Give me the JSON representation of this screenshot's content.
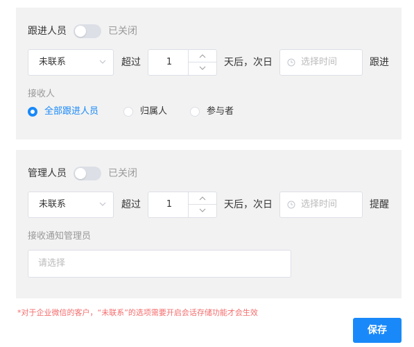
{
  "followup": {
    "label": "跟进人员",
    "toggle_state": "已关闭",
    "status_select": "未联系",
    "exceed_label": "超过",
    "days_value": "1",
    "days_suffix": "天后，次日",
    "time_placeholder": "选择时间",
    "action_label": "跟进",
    "receivers_label": "接收人",
    "receivers_options": [
      {
        "label": "全部跟进人员",
        "selected": true
      },
      {
        "label": "归属人",
        "selected": false
      },
      {
        "label": "参与者",
        "selected": false
      }
    ]
  },
  "manager": {
    "label": "管理人员",
    "toggle_state": "已关闭",
    "status_select": "未联系",
    "exceed_label": "超过",
    "days_value": "1",
    "days_suffix": "天后，次日",
    "time_placeholder": "选择时间",
    "action_label": "提醒",
    "notify_label": "接收通知管理员",
    "notify_placeholder": "请选择"
  },
  "note": "*对于企业微信的客户，“未联系”的选项需要开启会话存储功能才会生效",
  "save_label": "保存",
  "colors": {
    "accent": "#1989fa",
    "panel_bg": "#f2f2f2",
    "note_text": "#f56c6c",
    "toggle_off": "#dcdfe6"
  },
  "icons": [
    "chevron-down-icon",
    "chevron-up-icon",
    "clock-icon"
  ]
}
